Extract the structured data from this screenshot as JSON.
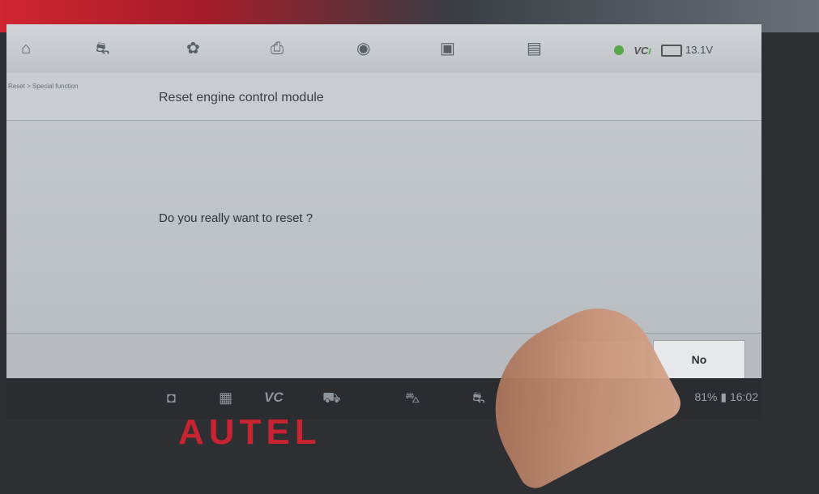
{
  "toolbar": {
    "icons": [
      {
        "name": "home-icon",
        "glyph": "⌂"
      },
      {
        "name": "car-icon",
        "glyph": "⛐"
      },
      {
        "name": "gear-icon",
        "glyph": "✿"
      },
      {
        "name": "print-icon",
        "glyph": "⎙"
      },
      {
        "name": "help-icon",
        "glyph": "◉"
      },
      {
        "name": "save-icon",
        "glyph": "▣"
      },
      {
        "name": "message-icon",
        "glyph": "▤"
      }
    ],
    "vci_label": "VC",
    "battery_voltage": "13.1V"
  },
  "breadcrumb": "Reset > Special function",
  "title": "Reset engine control module",
  "dialog": {
    "question": "Do you really want to reset ?",
    "yes_label": "",
    "no_label": "No"
  },
  "systembar": {
    "vci_label": "VC",
    "battery": "81%",
    "time": "16:02"
  },
  "brand": "AUTEL"
}
